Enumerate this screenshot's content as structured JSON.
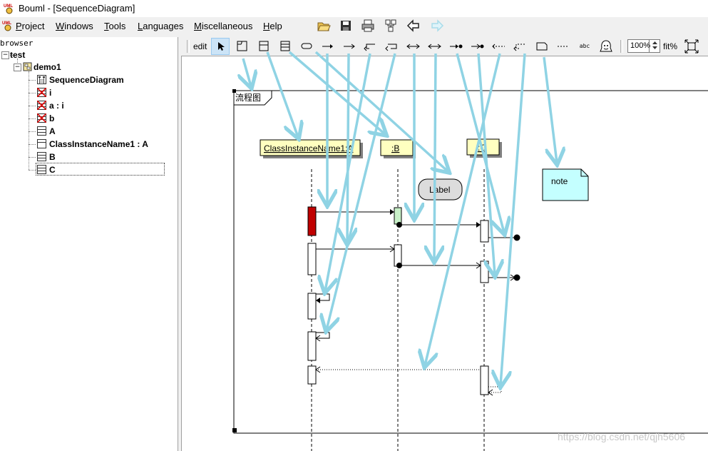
{
  "window": {
    "title": "Bouml - [SequenceDiagram]"
  },
  "menu": [
    {
      "label": "Project",
      "u": "P",
      "rest": "roject"
    },
    {
      "label": "Windows",
      "u": "W",
      "rest": "indows"
    },
    {
      "label": "Tools",
      "u": "T",
      "rest": "ools"
    },
    {
      "label": "Languages",
      "u": "L",
      "rest": "anguages"
    },
    {
      "label": "Miscellaneous",
      "u": "M",
      "rest": "iscellaneous"
    },
    {
      "label": "Help",
      "u": "H",
      "rest": "elp"
    }
  ],
  "browser": {
    "label": "browser",
    "items": [
      {
        "label": "test",
        "icon": "project-icon"
      },
      {
        "label": "demo1",
        "icon": "view-icon"
      },
      {
        "label": "SequenceDiagram",
        "icon": "sequence-diagram-icon"
      },
      {
        "label": "i",
        "icon": "deleted-class-icon"
      },
      {
        "label": "a : i",
        "icon": "deleted-class-icon"
      },
      {
        "label": "b",
        "icon": "deleted-class-icon"
      },
      {
        "label": "A",
        "icon": "class-icon"
      },
      {
        "label": "ClassInstanceName1 : A",
        "icon": "instance-icon"
      },
      {
        "label": "B",
        "icon": "class-icon"
      },
      {
        "label": "C",
        "icon": "class-icon"
      }
    ]
  },
  "toolbar": {
    "edit_label": "edit",
    "tools": [
      "select-arrow-icon",
      "fragment-icon",
      "instance-tool-icon",
      "class-tool-icon",
      "continuation-icon",
      "sync-message-icon",
      "async-message-icon",
      "sync-return-icon",
      "async-return-icon",
      "sync-self-message-icon",
      "async-self-message-icon",
      "lost-sync-icon",
      "lost-async-icon",
      "found-message-icon",
      "found-return-icon",
      "note-icon",
      "anchor-icon",
      "text-icon",
      "image-icon"
    ],
    "text_tool_label": "abc",
    "zoom_value": "100%",
    "fit_label": "fit%"
  },
  "diagram": {
    "frame_label": "流程图",
    "instances": [
      {
        "label": "ClassInstanceName1:A"
      },
      {
        "label": ":B"
      },
      {
        "label": ":C"
      }
    ],
    "continuation_label": "Label",
    "note_text": "note"
  },
  "colors": {
    "annotation_arrow": "#8fd3e4",
    "instance_fill": "#ffffc0",
    "note_fill": "#c4ffff",
    "selected_activation": "#c00000",
    "green_activation": "#c8f0c8"
  },
  "watermark": "https://blog.csdn.net/qjh5606"
}
